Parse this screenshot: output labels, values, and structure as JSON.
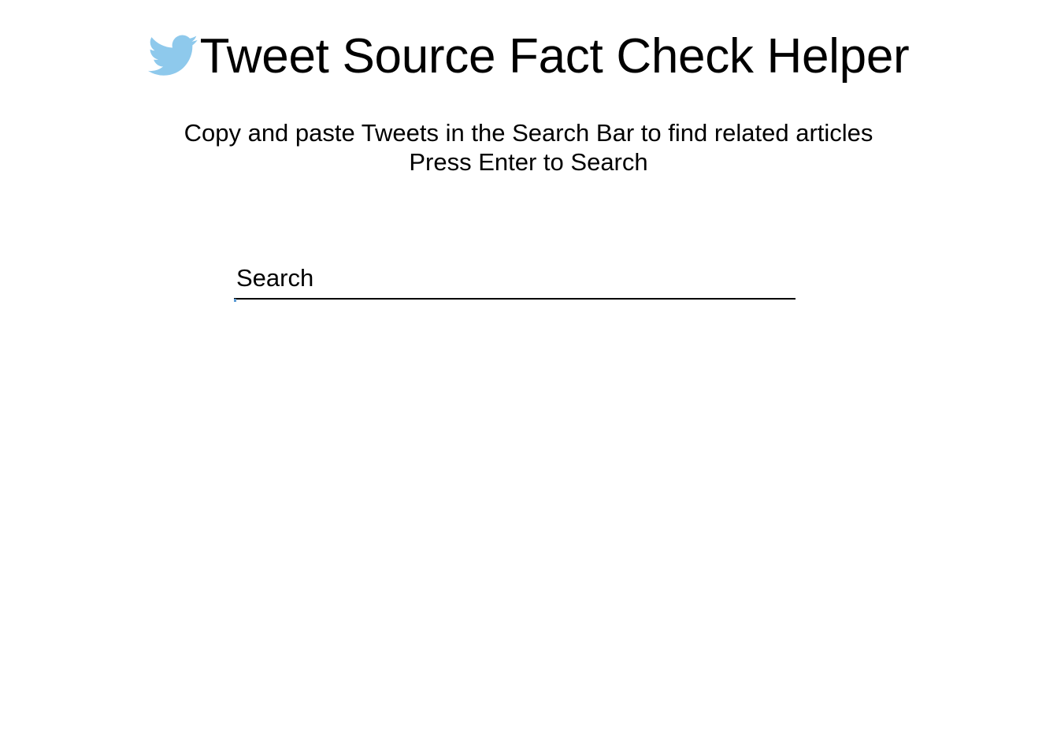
{
  "header": {
    "logo_icon": "twitter-bird-icon",
    "logo_color": "#8ec9ec",
    "title": "Tweet Source Fact Check Helper"
  },
  "instructions": {
    "line1": "Copy and paste Tweets in the Search Bar to find related articles",
    "line2": "Press Enter to Search"
  },
  "search": {
    "placeholder": "Search",
    "value": "",
    "focus_color": "#5b9bd5"
  }
}
